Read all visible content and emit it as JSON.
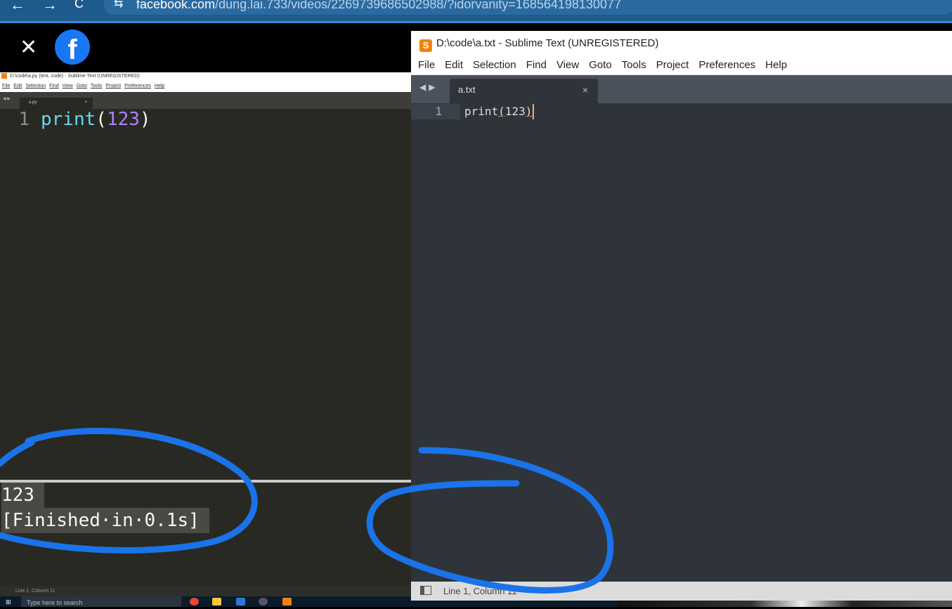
{
  "browser": {
    "back_icon": "←",
    "forward_icon": "→",
    "reload_icon": "C",
    "site_info_icon": "⇆",
    "url_domain": "facebook.com",
    "url_path": "/dung.lai.733/videos/2269739686502988/?idorvanity=168564198130077"
  },
  "viewer": {
    "close_icon": "✕",
    "logo_letter": "f"
  },
  "left_window": {
    "title": "D:\\code\\a.py (test, code) - Sublime Text (UNREGISTERED)",
    "menu": [
      "File",
      "Edit",
      "Selection",
      "Find",
      "View",
      "Goto",
      "Tools",
      "Project",
      "Preferences",
      "Help"
    ],
    "tab_arrows": "◀ ▶",
    "tab_label": "a.py",
    "tab_close": "×",
    "line_number": "1",
    "code_fn": "print",
    "code_open": "(",
    "code_num": "123",
    "code_close": ")",
    "output_line1": "123",
    "output_line2": "[Finished·in·0.1s]",
    "status": "Line 1, Column 11"
  },
  "right_window": {
    "app_icon": "S",
    "title": "D:\\code\\a.txt - Sublime Text (UNREGISTERED)",
    "menu": [
      "File",
      "Edit",
      "Selection",
      "Find",
      "View",
      "Goto",
      "Tools",
      "Project",
      "Preferences",
      "Help"
    ],
    "tab_arrows": "◀▶",
    "tab_label": "a.txt",
    "tab_close": "×",
    "line_number": "1",
    "code_pre": "print",
    "code_open": "(",
    "code_mid": "123",
    "code_close": ")",
    "status": "Line 1, Column 11"
  },
  "taskbar": {
    "start_icon": "⊞",
    "search_placeholder": "Type here to search"
  },
  "colors": {
    "annotation": "#1a73e8",
    "sublime_accent": "#f2820d",
    "facebook_blue": "#1877f2"
  }
}
